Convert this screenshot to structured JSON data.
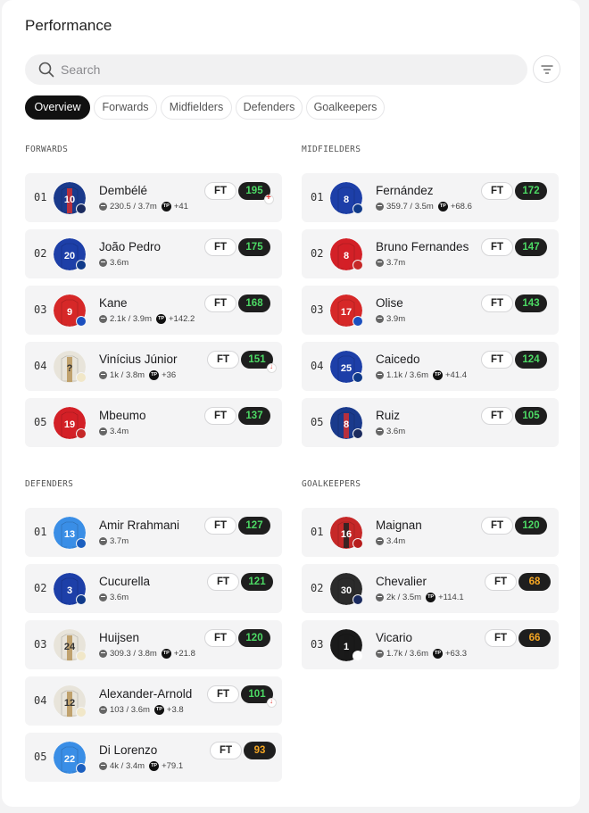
{
  "page": {
    "title": "Performance"
  },
  "search": {
    "placeholder": "Search"
  },
  "tabs": [
    "Overview",
    "Forwards",
    "Midfielders",
    "Defenders",
    "Goalkeepers"
  ],
  "active_tab": "Overview",
  "status_label": "FT",
  "colors": {
    "green_points": "#4cd964",
    "amber_points": "#f5a623",
    "pill_bg": "#1e1e1e"
  },
  "sections": {
    "forwards": {
      "label": "FORWARDS",
      "players": [
        {
          "rank": "01",
          "name": "Dembélé",
          "stat": "230.5 / 3.7m",
          "tp": "+41",
          "points": "195",
          "tone": "green",
          "flag": "plus",
          "kit": "#1a3a8c",
          "kit2": "#d32f2f",
          "number": "10",
          "badge": "#1a2a5e"
        },
        {
          "rank": "02",
          "name": "João Pedro",
          "stat": "3.6m",
          "tp": "",
          "points": "175",
          "tone": "green",
          "flag": "",
          "kit": "#1d3fa8",
          "kit2": "#1d3fa8",
          "number": "20",
          "badge": "#103a8a"
        },
        {
          "rank": "03",
          "name": "Kane",
          "stat": "2.1k / 3.9m",
          "tp": "+142.2",
          "points": "168",
          "tone": "green",
          "flag": "",
          "kit": "#d62828",
          "kit2": "#d62828",
          "number": "9",
          "badge": "#1b4fbf"
        },
        {
          "rank": "04",
          "name": "Vinícius Júnior",
          "stat": "1k / 3.8m",
          "tp": "+36",
          "points": "151",
          "tone": "green",
          "flag": "down",
          "kit": "#e8e4da",
          "kit2": "#b9975b",
          "number": "?",
          "badge": "#f1e7c8"
        },
        {
          "rank": "05",
          "name": "Mbeumo",
          "stat": "3.4m",
          "tp": "",
          "points": "137",
          "tone": "green",
          "flag": "",
          "kit": "#d32027",
          "kit2": "#d32027",
          "number": "19",
          "badge": "#c62828"
        }
      ]
    },
    "midfielders": {
      "label": "MIDFIELDERS",
      "players": [
        {
          "rank": "01",
          "name": "Fernández",
          "stat": "359.7 / 3.5m",
          "tp": "+68.6",
          "points": "172",
          "tone": "green",
          "flag": "",
          "kit": "#1d3fa8",
          "kit2": "#1d3fa8",
          "number": "8",
          "badge": "#103a8a"
        },
        {
          "rank": "02",
          "name": "Bruno Fernandes",
          "stat": "3.7m",
          "tp": "",
          "points": "147",
          "tone": "green",
          "flag": "",
          "kit": "#d32027",
          "kit2": "#d32027",
          "number": "8",
          "badge": "#c62828"
        },
        {
          "rank": "03",
          "name": "Olise",
          "stat": "3.9m",
          "tp": "",
          "points": "143",
          "tone": "green",
          "flag": "",
          "kit": "#d62828",
          "kit2": "#d62828",
          "number": "17",
          "badge": "#1b4fbf"
        },
        {
          "rank": "04",
          "name": "Caicedo",
          "stat": "1.1k / 3.6m",
          "tp": "+41.4",
          "points": "124",
          "tone": "green",
          "flag": "",
          "kit": "#1d3fa8",
          "kit2": "#1d3fa8",
          "number": "25",
          "badge": "#103a8a"
        },
        {
          "rank": "05",
          "name": "Ruiz",
          "stat": "3.6m",
          "tp": "",
          "points": "105",
          "tone": "green",
          "flag": "",
          "kit": "#1a3a8c",
          "kit2": "#d32f2f",
          "number": "8",
          "badge": "#1a2a5e"
        }
      ]
    },
    "defenders": {
      "label": "DEFENDERS",
      "players": [
        {
          "rank": "01",
          "name": "Amir Rrahmani",
          "stat": "3.7m",
          "tp": "",
          "points": "127",
          "tone": "green",
          "flag": "",
          "kit": "#3a8ee6",
          "kit2": "#3a8ee6",
          "number": "13",
          "badge": "#1b5fbf"
        },
        {
          "rank": "02",
          "name": "Cucurella",
          "stat": "3.6m",
          "tp": "",
          "points": "121",
          "tone": "green",
          "flag": "",
          "kit": "#1d3fa8",
          "kit2": "#1d3fa8",
          "number": "3",
          "badge": "#103a8a"
        },
        {
          "rank": "03",
          "name": "Huijsen",
          "stat": "309.3 / 3.8m",
          "tp": "+21.8",
          "points": "120",
          "tone": "green",
          "flag": "",
          "kit": "#e8e4da",
          "kit2": "#b9975b",
          "number": "24",
          "badge": "#f1e7c8"
        },
        {
          "rank": "04",
          "name": "Alexander-Arnold",
          "stat": "103 / 3.6m",
          "tp": "+3.8",
          "points": "101",
          "tone": "green",
          "flag": "down",
          "kit": "#e8e4da",
          "kit2": "#b9975b",
          "number": "12",
          "badge": "#f1e7c8"
        },
        {
          "rank": "05",
          "name": "Di Lorenzo",
          "stat": "4k / 3.4m",
          "tp": "+79.1",
          "points": "93",
          "tone": "amber",
          "flag": "",
          "kit": "#3a8ee6",
          "kit2": "#3a8ee6",
          "number": "22",
          "badge": "#1b5fbf"
        }
      ]
    },
    "goalkeepers": {
      "label": "GOALKEEPERS",
      "players": [
        {
          "rank": "01",
          "name": "Maignan",
          "stat": "3.4m",
          "tp": "",
          "points": "120",
          "tone": "green",
          "flag": "",
          "kit": "#c62828",
          "kit2": "#222222",
          "number": "16",
          "badge": "#b71c1c"
        },
        {
          "rank": "02",
          "name": "Chevalier",
          "stat": "2k / 3.5m",
          "tp": "+114.1",
          "points": "68",
          "tone": "amber",
          "flag": "",
          "kit": "#2b2b2b",
          "kit2": "#2b2b2b",
          "number": "30",
          "badge": "#1a2a5e"
        },
        {
          "rank": "03",
          "name": "Vicario",
          "stat": "1.7k / 3.6m",
          "tp": "+63.3",
          "points": "66",
          "tone": "amber",
          "flag": "",
          "kit": "#1a1a1a",
          "kit2": "#1a1a1a",
          "number": "1",
          "badge": "#ffffff"
        }
      ]
    }
  }
}
